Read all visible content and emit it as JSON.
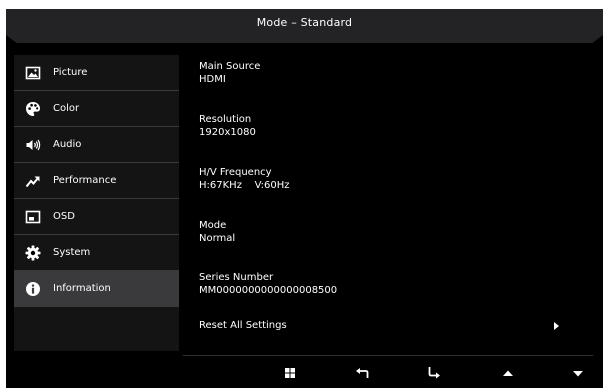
{
  "header": {
    "title": "Mode – Standard"
  },
  "sidebar": {
    "items": [
      {
        "label": "Picture",
        "icon": "picture-icon"
      },
      {
        "label": "Color",
        "icon": "palette-icon"
      },
      {
        "label": "Audio",
        "icon": "speaker-icon"
      },
      {
        "label": "Performance",
        "icon": "trend-arrow-icon"
      },
      {
        "label": "OSD",
        "icon": "osd-window-icon"
      },
      {
        "label": "System",
        "icon": "gear-icon"
      },
      {
        "label": "Information",
        "icon": "info-icon",
        "selected": true
      }
    ]
  },
  "info": {
    "main_source_label": "Main Source",
    "main_source_value": "HDMI",
    "resolution_label": "Resolution",
    "resolution_value": "1920x1080",
    "frequency_label": "H/V Frequency",
    "frequency_value": "H:67KHz    V:60Hz",
    "mode_label": "Mode",
    "mode_value": "Normal",
    "series_label": "Series Number",
    "series_value": "MM0000000000000008500",
    "reset_label": "Reset All Settings"
  },
  "bottom_bar": {
    "buttons": [
      "menu-grid-icon",
      "back-arrow-icon",
      "enter-arrow-icon",
      "up-triangle-icon",
      "down-triangle-icon"
    ]
  },
  "colors": {
    "background": "#000000",
    "sidebar": "#141414",
    "selected": "#3a3a3c",
    "title_bar": "#232325",
    "text": "#ffffff"
  }
}
